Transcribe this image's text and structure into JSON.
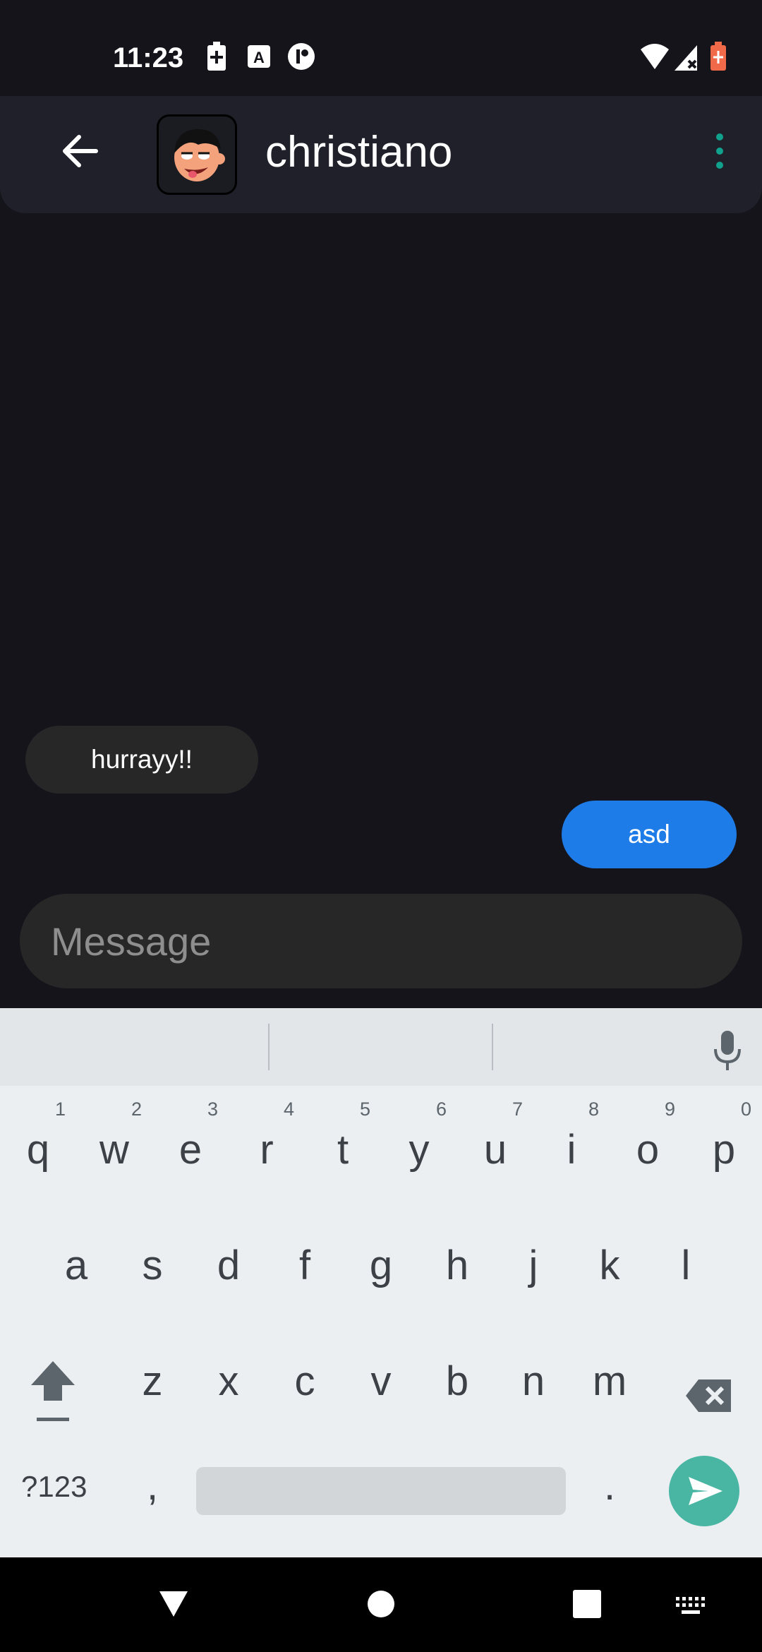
{
  "status_bar": {
    "time": "11:23"
  },
  "header": {
    "contact_name": "christiano"
  },
  "messages": [
    {
      "direction": "incoming",
      "text": "hurrayy!!"
    },
    {
      "direction": "outgoing",
      "text": "asd"
    }
  ],
  "composer": {
    "placeholder": "Message"
  },
  "keyboard": {
    "row1": [
      "q",
      "w",
      "e",
      "r",
      "t",
      "y",
      "u",
      "i",
      "o",
      "p"
    ],
    "row1_hints": [
      "1",
      "2",
      "3",
      "4",
      "5",
      "6",
      "7",
      "8",
      "9",
      "0"
    ],
    "row2": [
      "a",
      "s",
      "d",
      "f",
      "g",
      "h",
      "j",
      "k",
      "l"
    ],
    "row3": [
      "z",
      "x",
      "c",
      "v",
      "b",
      "n",
      "m"
    ],
    "symbols_label": "?123",
    "comma": ",",
    "period": "."
  },
  "colors": {
    "outgoing_bubble": "#1e7ce8",
    "accent": "#11a28e",
    "send_key": "#49b6a4"
  },
  "icons": [
    "back-arrow-icon",
    "avatar",
    "more-vert-icon",
    "mic-icon",
    "shift-icon",
    "backspace-icon",
    "send-icon",
    "nav-back-icon",
    "nav-home-icon",
    "nav-recents-icon",
    "keyboard-switch-icon"
  ]
}
